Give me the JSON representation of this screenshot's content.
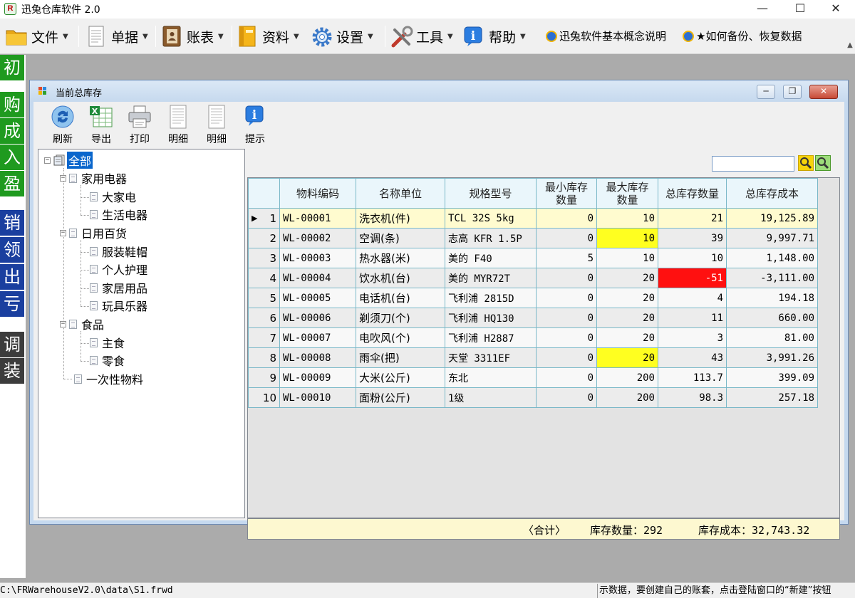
{
  "window": {
    "title": "迅兔仓库软件 2.0",
    "logo_text": "R"
  },
  "menubar": {
    "menus": [
      {
        "label": "文件",
        "icon": "folder-icon"
      },
      {
        "label": "单据",
        "icon": "document-icon"
      },
      {
        "label": "账表",
        "icon": "ledger-book-icon"
      },
      {
        "label": "资料",
        "icon": "binder-icon"
      },
      {
        "label": "设置",
        "icon": "gear-icon"
      },
      {
        "label": "工具",
        "icon": "tools-icon"
      },
      {
        "label": "帮助",
        "icon": "help-info-icon"
      }
    ],
    "links": [
      {
        "label": "迅兔软件基本概念说明",
        "icon": "ie-globe-icon"
      },
      {
        "label": "★如何备份、恢复数据",
        "icon": "ie-globe-icon"
      }
    ]
  },
  "sidebar": {
    "buttons": [
      {
        "label": "初",
        "color": "#1f9a1f"
      },
      {
        "label": "购",
        "color": "#1f9a1f"
      },
      {
        "label": "成",
        "color": "#1f9a1f"
      },
      {
        "label": "入",
        "color": "#1f9a1f"
      },
      {
        "label": "盈",
        "color": "#1f9a1f"
      },
      {
        "label": "销",
        "color": "#1a3f9f"
      },
      {
        "label": "领",
        "color": "#1a3f9f"
      },
      {
        "label": "出",
        "color": "#1a3f9f"
      },
      {
        "label": "亏",
        "color": "#1a3f9f"
      },
      {
        "label": "调",
        "color": "#3c3c3c"
      },
      {
        "label": "装",
        "color": "#3c3c3c"
      }
    ]
  },
  "child_window": {
    "title": "当前总库存",
    "toolbar": [
      {
        "label": "刷新",
        "icon": "refresh-icon"
      },
      {
        "label": "导出",
        "icon": "excel-export-icon"
      },
      {
        "label": "打印",
        "icon": "printer-icon"
      },
      {
        "label": "明细",
        "icon": "detail-sheet-icon"
      },
      {
        "label": "明细",
        "icon": "detail-sheet-icon"
      },
      {
        "label": "提示",
        "icon": "info-icon"
      }
    ],
    "search": {
      "value": "",
      "placeholder": ""
    }
  },
  "tree": {
    "root": "全部",
    "groups": [
      {
        "label": "家用电器",
        "children": [
          "大家电",
          "生活电器"
        ]
      },
      {
        "label": "日用百货",
        "children": [
          "服装鞋帽",
          "个人护理",
          "家居用品",
          "玩具乐器"
        ]
      },
      {
        "label": "食品",
        "children": [
          "主食",
          "零食"
        ]
      },
      {
        "label": "一次性物料",
        "children": []
      }
    ]
  },
  "grid": {
    "columns": [
      "物料编码",
      "名称单位",
      "规格型号",
      "最小库存数量",
      "最大库存数量",
      "总库存数量",
      "总库存成本"
    ],
    "columns_display": [
      "物料编码",
      "名称单位",
      "规格型号",
      "最小库存\n数量",
      "最大库存\n数量",
      "总库存数量",
      "总库存成本"
    ],
    "rows": [
      {
        "no": "1",
        "code": "WL-00001",
        "name": "洗衣机(件)",
        "spec": "TCL 32S 5kg",
        "min": "0",
        "max": "10",
        "qty": "21",
        "cost": "19,125.89",
        "max_flag": "",
        "qty_flag": ""
      },
      {
        "no": "2",
        "code": "WL-00002",
        "name": "空调(条)",
        "spec": "志高 KFR 1.5P",
        "min": "0",
        "max": "10",
        "qty": "39",
        "cost": "9,997.71",
        "max_flag": "yellow",
        "qty_flag": ""
      },
      {
        "no": "3",
        "code": "WL-00003",
        "name": "热水器(米)",
        "spec": "美的 F40",
        "min": "5",
        "max": "10",
        "qty": "10",
        "cost": "1,148.00",
        "max_flag": "",
        "qty_flag": ""
      },
      {
        "no": "4",
        "code": "WL-00004",
        "name": "饮水机(台)",
        "spec": "美的 MYR72T",
        "min": "0",
        "max": "20",
        "qty": "-51",
        "cost": "-3,111.00",
        "max_flag": "",
        "qty_flag": "red"
      },
      {
        "no": "5",
        "code": "WL-00005",
        "name": "电话机(台)",
        "spec": "飞利浦 2815D",
        "min": "0",
        "max": "20",
        "qty": "4",
        "cost": "194.18",
        "max_flag": "",
        "qty_flag": ""
      },
      {
        "no": "6",
        "code": "WL-00006",
        "name": "剃须刀(个)",
        "spec": "飞利浦 HQ130",
        "min": "0",
        "max": "20",
        "qty": "11",
        "cost": "660.00",
        "max_flag": "",
        "qty_flag": ""
      },
      {
        "no": "7",
        "code": "WL-00007",
        "name": "电吹风(个)",
        "spec": "飞利浦 H2887",
        "min": "0",
        "max": "20",
        "qty": "3",
        "cost": "81.00",
        "max_flag": "",
        "qty_flag": ""
      },
      {
        "no": "8",
        "code": "WL-00008",
        "name": "雨伞(把)",
        "spec": "天堂 3311EF",
        "min": "0",
        "max": "20",
        "qty": "43",
        "cost": "3,991.26",
        "max_flag": "yellow",
        "qty_flag": ""
      },
      {
        "no": "9",
        "code": "WL-00009",
        "name": "大米(公斤)",
        "spec": "东北",
        "min": "0",
        "max": "200",
        "qty": "113.7",
        "cost": "399.09",
        "max_flag": "",
        "qty_flag": ""
      },
      {
        "no": "10",
        "code": "WL-00010",
        "name": "面粉(公斤)",
        "spec": "1级",
        "min": "0",
        "max": "200",
        "qty": "98.3",
        "cost": "257.18",
        "max_flag": "",
        "qty_flag": ""
      }
    ],
    "current_row": "1"
  },
  "summary": {
    "label": "〈合计〉",
    "qty_text": "库存数量：292",
    "cost_text": "库存成本：32,743.32"
  },
  "statusbar": {
    "path": "C:\\FRWarehouseV2.0\\data\\S1.frwd",
    "message": "示数据，要创建自己的账套，点击登陆窗口的“新建”按钮"
  },
  "colors": {
    "highlight_yellow": "#ffff20",
    "highlight_red": "#ff1010",
    "selection_blue": "#0a66cc",
    "current_row": "#fffbcf"
  }
}
